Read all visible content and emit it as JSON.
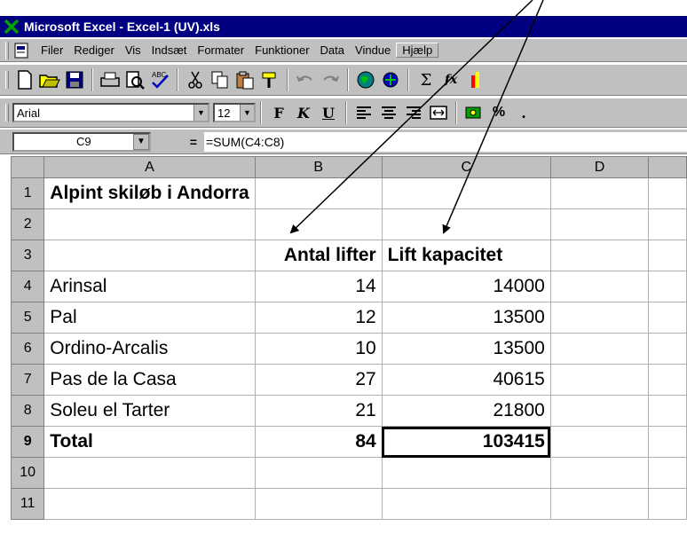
{
  "window": {
    "title": "Microsoft Excel - Excel-1 (UV).xls"
  },
  "menu": {
    "items": [
      "Filer",
      "Rediger",
      "Vis",
      "Indsæt",
      "Formater",
      "Funktioner",
      "Data",
      "Vindue",
      "Hjælp"
    ]
  },
  "toolbar": {
    "icons": [
      "new-icon",
      "open-icon",
      "save-icon",
      "print-icon",
      "print-preview-icon",
      "spelling-icon",
      "cut-icon",
      "copy-icon",
      "paste-icon",
      "format-painter-icon",
      "undo-icon",
      "redo-icon",
      "web-icon",
      "hyperlink-icon",
      "autosum-icon",
      "function-icon"
    ],
    "autosum_label": "Σ",
    "function_label": "fx"
  },
  "format": {
    "font": "Arial",
    "size": "12",
    "bold_label": "F",
    "italic_label": "K",
    "underline_label": "U",
    "percent_label": "%"
  },
  "formula_bar": {
    "name_box": "C9",
    "equals": "=",
    "formula": "=SUM(C4:C8)"
  },
  "sheet": {
    "columns": [
      "A",
      "B",
      "C",
      "D"
    ],
    "rows": [
      {
        "n": "1",
        "a": "Alpint skiløb i Andorra",
        "b": "",
        "c": ""
      },
      {
        "n": "2",
        "a": "",
        "b": "",
        "c": ""
      },
      {
        "n": "3",
        "a": "",
        "b": "Antal lifter",
        "c": "Lift kapacitet"
      },
      {
        "n": "4",
        "a": "Arinsal",
        "b": "14",
        "c": "14000"
      },
      {
        "n": "5",
        "a": "Pal",
        "b": "12",
        "c": "13500"
      },
      {
        "n": "6",
        "a": "Ordino-Arcalis",
        "b": "10",
        "c": "13500"
      },
      {
        "n": "7",
        "a": "Pas de la Casa",
        "b": "27",
        "c": "40615"
      },
      {
        "n": "8",
        "a": "Soleu el Tarter",
        "b": "21",
        "c": "21800"
      },
      {
        "n": "9",
        "a": "Total",
        "b": "84",
        "c": "103415"
      },
      {
        "n": "10",
        "a": "",
        "b": "",
        "c": ""
      },
      {
        "n": "11",
        "a": "",
        "b": "",
        "c": ""
      }
    ],
    "selected_cell": "C9"
  },
  "colors": {
    "title_bar": "#000080",
    "chrome": "#c0c0c0"
  }
}
